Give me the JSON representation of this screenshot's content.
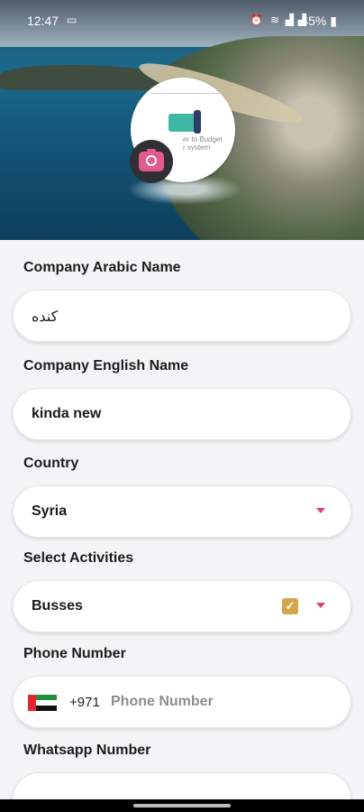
{
  "status_bar": {
    "time": "12:47",
    "battery": "45%"
  },
  "form": {
    "arabic_name": {
      "label": "Company Arabic Name",
      "value": "كنده"
    },
    "english_name": {
      "label": "Company English Name",
      "value": "kinda new"
    },
    "country": {
      "label": "Country",
      "value": "Syria"
    },
    "activities": {
      "label": "Select Activities",
      "value": "Busses"
    },
    "phone": {
      "label": "Phone Number",
      "code": "+971",
      "placeholder": "Phone Number"
    },
    "whatsapp": {
      "label": "Whatsapp Number"
    }
  },
  "avatar_caption": "er to Budget\nr system",
  "colors": {
    "accent": "#e0406e",
    "checkbox": "#d4a64a",
    "camera": "#e35a8d"
  }
}
